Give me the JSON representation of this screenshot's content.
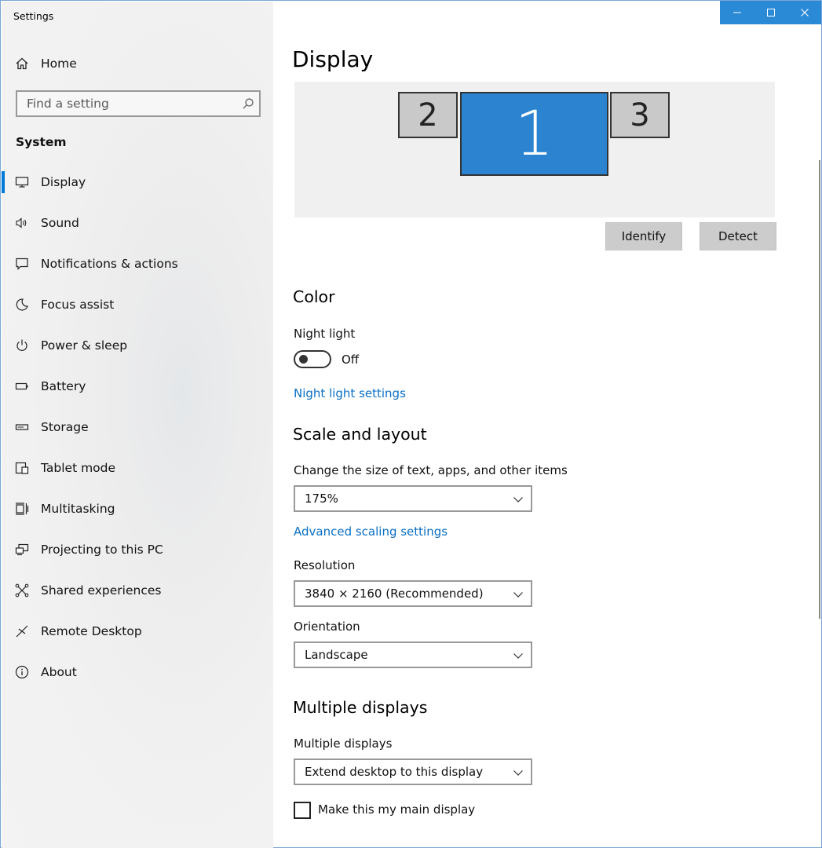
{
  "window": {
    "title": "Settings"
  },
  "titlebar": {
    "minimize": "─",
    "maximize": "☐",
    "close": "✕"
  },
  "sidebar": {
    "home_label": "Home",
    "search_placeholder": "Find a setting",
    "section": "System",
    "items": [
      {
        "label": "Display",
        "icon": "monitor-icon",
        "selected": true
      },
      {
        "label": "Sound",
        "icon": "speaker-icon"
      },
      {
        "label": "Notifications & actions",
        "icon": "message-icon"
      },
      {
        "label": "Focus assist",
        "icon": "moon-icon"
      },
      {
        "label": "Power & sleep",
        "icon": "power-icon"
      },
      {
        "label": "Battery",
        "icon": "battery-icon"
      },
      {
        "label": "Storage",
        "icon": "storage-icon"
      },
      {
        "label": "Tablet mode",
        "icon": "tablet-icon"
      },
      {
        "label": "Multitasking",
        "icon": "multitasking-icon"
      },
      {
        "label": "Projecting to this PC",
        "icon": "projecting-icon"
      },
      {
        "label": "Shared experiences",
        "icon": "shared-icon"
      },
      {
        "label": "Remote Desktop",
        "icon": "remote-desktop-icon"
      },
      {
        "label": "About",
        "icon": "info-icon"
      }
    ]
  },
  "main": {
    "title": "Display",
    "monitors": {
      "left": "2",
      "primary": "1",
      "right": "3"
    },
    "identify_label": "Identify",
    "detect_label": "Detect",
    "color": {
      "heading": "Color",
      "night_light_label": "Night light",
      "night_light_state": "Off",
      "night_light_settings_link": "Night light settings"
    },
    "scale": {
      "heading": "Scale and layout",
      "size_label": "Change the size of text, apps, and other items",
      "size_value": "175%",
      "advanced_link": "Advanced scaling settings",
      "resolution_label": "Resolution",
      "resolution_value": "3840 × 2160 (Recommended)",
      "orientation_label": "Orientation",
      "orientation_value": "Landscape"
    },
    "multiple": {
      "heading": "Multiple displays",
      "label": "Multiple displays",
      "value": "Extend desktop to this display",
      "main_display_label": "Make this my main display"
    }
  },
  "colors": {
    "accent": "#0078d7",
    "link": "#0a6fc4",
    "primary_monitor": "#2c84d1"
  }
}
